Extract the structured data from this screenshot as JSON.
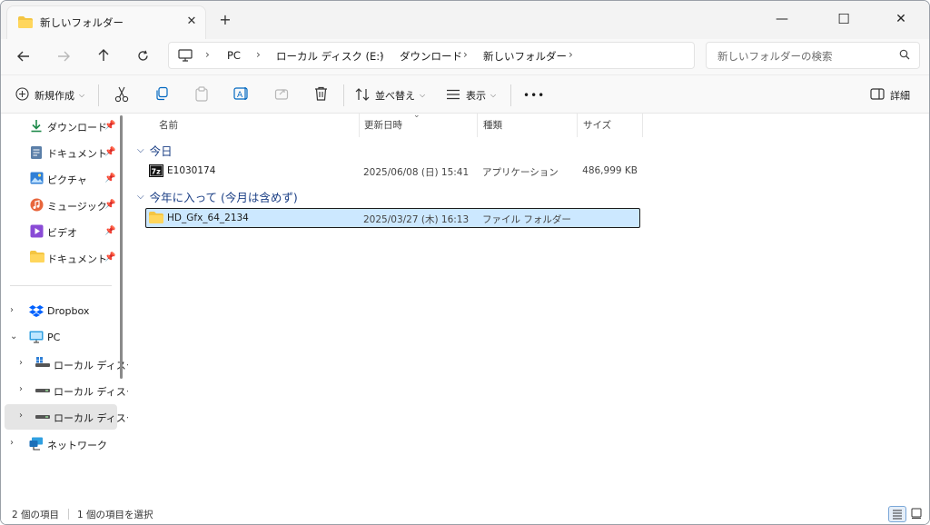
{
  "window": {
    "tab_title": "新しいフォルダー",
    "new_tab": "+",
    "minimize": "—",
    "maximize": "☐",
    "close": "✕"
  },
  "address": {
    "breadcrumbs": [
      "PC",
      "ローカル ディスク (E:)",
      "ダウンロード",
      "新しいフォルダー"
    ],
    "search_placeholder": "新しいフォルダーの検索"
  },
  "commands": {
    "new_label": "新規作成",
    "sort_label": "並べ替え",
    "view_label": "表示",
    "more": "•••",
    "details_label": "詳細"
  },
  "sidebar": {
    "quick": [
      {
        "label": "ダウンロード",
        "icon": "download-icon"
      },
      {
        "label": "ドキュメント",
        "icon": "document-icon"
      },
      {
        "label": "ピクチャ",
        "icon": "picture-icon"
      },
      {
        "label": "ミュージック",
        "icon": "music-icon"
      },
      {
        "label": "ビデオ",
        "icon": "video-icon"
      },
      {
        "label": "ドキュメント",
        "icon": "folder-icon"
      }
    ],
    "tree": [
      {
        "label": "Dropbox",
        "icon": "dropbox-icon"
      },
      {
        "label": "PC",
        "icon": "monitor-icon"
      },
      {
        "label": "ローカル ディスク",
        "icon": "drive-windows-icon"
      },
      {
        "label": "ローカル ディスク",
        "icon": "drive-icon"
      },
      {
        "label": "ローカル ディスク",
        "icon": "drive-icon"
      },
      {
        "label": "ネットワーク",
        "icon": "network-icon"
      }
    ]
  },
  "columns": {
    "name": "名前",
    "modified": "更新日時",
    "type": "種類",
    "size": "サイズ"
  },
  "groups": [
    {
      "label": "今日",
      "files": [
        {
          "name": "E1030174",
          "modified": "2025/06/08 (日) 15:41",
          "type": "アプリケーション",
          "size": "486,999 KB",
          "icon": "7zip-icon"
        }
      ]
    },
    {
      "label": "今年に入って (今月は含めず)",
      "files": [
        {
          "name": "HD_Gfx_64_2134",
          "modified": "2025/03/27 (木) 16:13",
          "type": "ファイル フォルダー",
          "size": "",
          "icon": "folder-icon"
        }
      ]
    }
  ],
  "status": {
    "item_count": "2 個の項目",
    "selected_count": "1 個の項目を選択"
  },
  "colors": {
    "accent": "#0067c0",
    "selection": "#cce8ff",
    "group_text": "#1b3f85",
    "folder": "#f4c542"
  }
}
